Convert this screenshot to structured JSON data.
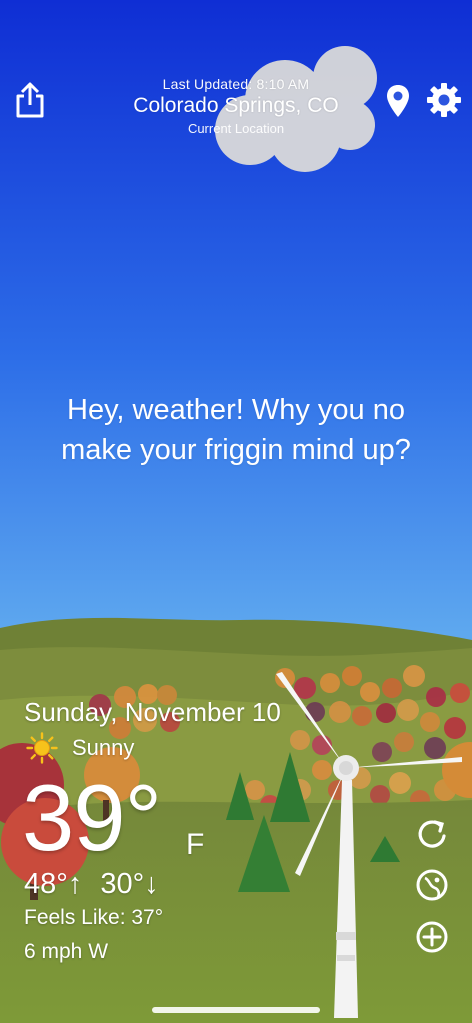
{
  "header": {
    "last_updated": "Last Updated: 8:10 AM",
    "city": "Colorado Springs, CO",
    "current_location": "Current Location"
  },
  "top_bar": {
    "share_icon": "share-icon",
    "location_icon": "location-pin-icon",
    "settings_icon": "gear-icon"
  },
  "message": {
    "line1": "Hey, weather! Why you no",
    "line2": "make your friggin mind up?"
  },
  "weather": {
    "date": "Sunday, November 10",
    "condition_icon": "sun-icon",
    "condition": "Sunny",
    "temperature": "39°",
    "unit": "F",
    "high": "48°↑",
    "low": "30°↓",
    "feels_like": "Feels Like: 37°",
    "wind": "6 mph W"
  },
  "side_buttons": [
    "refresh-icon",
    "radar-icon",
    "add-icon"
  ],
  "colors": {
    "sky_top": "#0f33d6",
    "sky_bottom": "#5aa6ee",
    "hill": "#7a8f3a",
    "foreground": "#7c963a",
    "sun": "#f7c21b"
  }
}
